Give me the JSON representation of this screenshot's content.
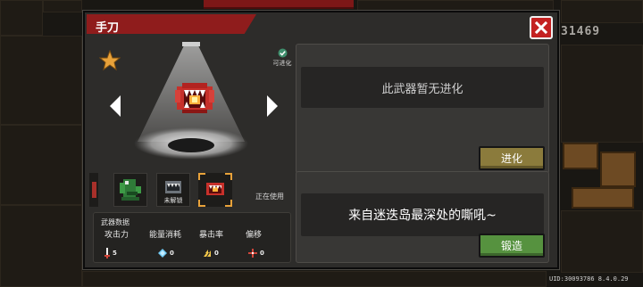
{
  "title": "手刀",
  "close_icon": "close-x-icon",
  "evolvable_label": "可进化",
  "weapon_slots": [
    {
      "icon": "green-creature-weapon-icon",
      "label": ""
    },
    {
      "icon": "jaw-trap-weapon-icon",
      "label": "未解锁"
    },
    {
      "icon": "red-mouth-weapon-icon",
      "label": ""
    }
  ],
  "in_use_label": "正在使用",
  "stats": {
    "title": "武器数据",
    "items": [
      {
        "label": "攻击力",
        "value": "5",
        "icon": "sword-icon"
      },
      {
        "label": "能量消耗",
        "value": "0",
        "icon": "energy-crystal-icon"
      },
      {
        "label": "暴击率",
        "value": "0",
        "icon": "crit-bolt-icon"
      },
      {
        "label": "偏移",
        "value": "0",
        "icon": "crosshair-icon"
      }
    ]
  },
  "evolution": {
    "text": "此武器暂无进化",
    "button": "进化"
  },
  "description": {
    "text": "来自迷迭岛最深处的嘶吼~",
    "button": "锻造"
  },
  "background": {
    "score": "31469"
  },
  "uid_text": "UID:30093786 8.4.0.29",
  "colors": {
    "title_bar": "#8f1c1c",
    "close_button": "#c42121",
    "evolve_button": "#8b7b3c",
    "forge_button": "#56923f",
    "selected_corner": "#e8a23a"
  }
}
